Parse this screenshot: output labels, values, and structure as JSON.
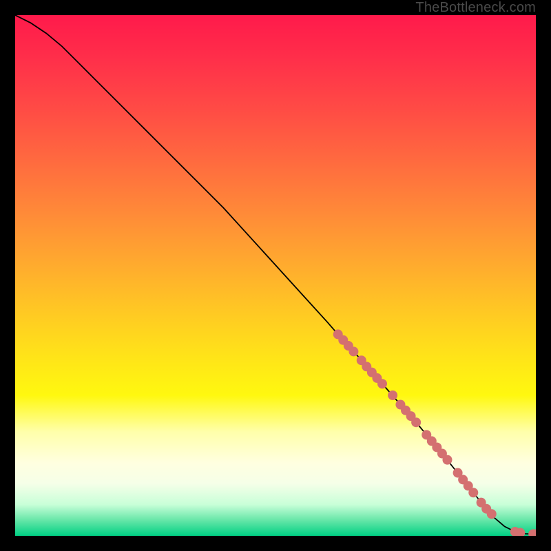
{
  "watermark": "TheBottleneck.com",
  "colors": {
    "page_bg": "#000000",
    "line": "#000000",
    "dot": "#d47070",
    "gradient_top": "#ff1a4b",
    "gradient_bottom": "#00d084"
  },
  "chart_data": {
    "type": "line",
    "title": "",
    "xlabel": "",
    "ylabel": "",
    "xlim": [
      0,
      100
    ],
    "ylim": [
      0,
      100
    ],
    "series": [
      {
        "name": "curve",
        "x": [
          0,
          3,
          6,
          9,
          12,
          15,
          20,
          25,
          30,
          35,
          40,
          45,
          50,
          55,
          60,
          62,
          64,
          66,
          68,
          70,
          72,
          74,
          76,
          78,
          80,
          82,
          84,
          86,
          88,
          90,
          92,
          94,
          96,
          98,
          99,
          100
        ],
        "y": [
          100,
          98.5,
          96.5,
          94,
          91,
          88,
          83,
          78,
          73,
          68,
          63,
          57.5,
          52,
          46.5,
          41,
          38.7,
          36.5,
          34.3,
          32,
          29.8,
          27.5,
          25.2,
          23,
          20.6,
          18.2,
          15.8,
          13.3,
          10.8,
          8.3,
          5.8,
          3.5,
          1.8,
          0.8,
          0.4,
          0.35,
          0.35
        ]
      }
    ],
    "markers": [
      {
        "x": 62.0,
        "y": 38.7
      },
      {
        "x": 63.0,
        "y": 37.6
      },
      {
        "x": 64.0,
        "y": 36.5
      },
      {
        "x": 65.0,
        "y": 35.4
      },
      {
        "x": 66.5,
        "y": 33.7
      },
      {
        "x": 67.5,
        "y": 32.5
      },
      {
        "x": 68.5,
        "y": 31.4
      },
      {
        "x": 69.5,
        "y": 30.3
      },
      {
        "x": 70.5,
        "y": 29.2
      },
      {
        "x": 72.5,
        "y": 27.0
      },
      {
        "x": 74.0,
        "y": 25.2
      },
      {
        "x": 75.0,
        "y": 24.1
      },
      {
        "x": 76.0,
        "y": 23.0
      },
      {
        "x": 77.0,
        "y": 21.8
      },
      {
        "x": 79.0,
        "y": 19.4
      },
      {
        "x": 80.0,
        "y": 18.2
      },
      {
        "x": 81.0,
        "y": 17.0
      },
      {
        "x": 82.0,
        "y": 15.8
      },
      {
        "x": 83.0,
        "y": 14.6
      },
      {
        "x": 85.0,
        "y": 12.1
      },
      {
        "x": 86.0,
        "y": 10.8
      },
      {
        "x": 87.0,
        "y": 9.6
      },
      {
        "x": 88.0,
        "y": 8.3
      },
      {
        "x": 89.5,
        "y": 6.4
      },
      {
        "x": 90.5,
        "y": 5.2
      },
      {
        "x": 91.5,
        "y": 4.2
      },
      {
        "x": 96.0,
        "y": 0.8
      },
      {
        "x": 97.0,
        "y": 0.6
      },
      {
        "x": 99.5,
        "y": 0.35
      },
      {
        "x": 100.0,
        "y": 0.35
      }
    ]
  }
}
